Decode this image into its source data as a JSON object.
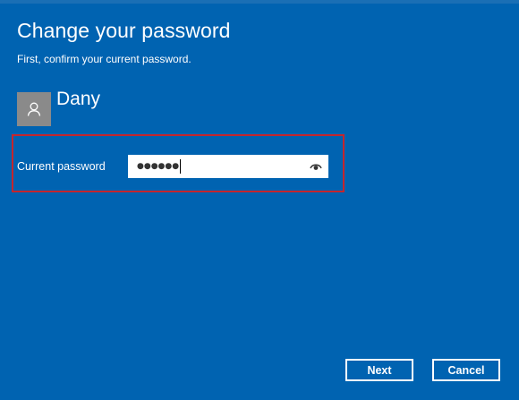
{
  "dialog": {
    "title": "Change your password",
    "subtitle": "First, confirm your current password."
  },
  "user": {
    "name": "Dany",
    "avatar_icon": "user-silhouette-icon"
  },
  "password_field": {
    "label": "Current password",
    "value_masked": "●●●●●●",
    "reveal_icon": "eye-icon",
    "highlight_color": "#c4262e"
  },
  "buttons": {
    "next_label": "Next",
    "cancel_label": "Cancel"
  },
  "colors": {
    "background": "#0063b1",
    "text": "#ffffff"
  }
}
